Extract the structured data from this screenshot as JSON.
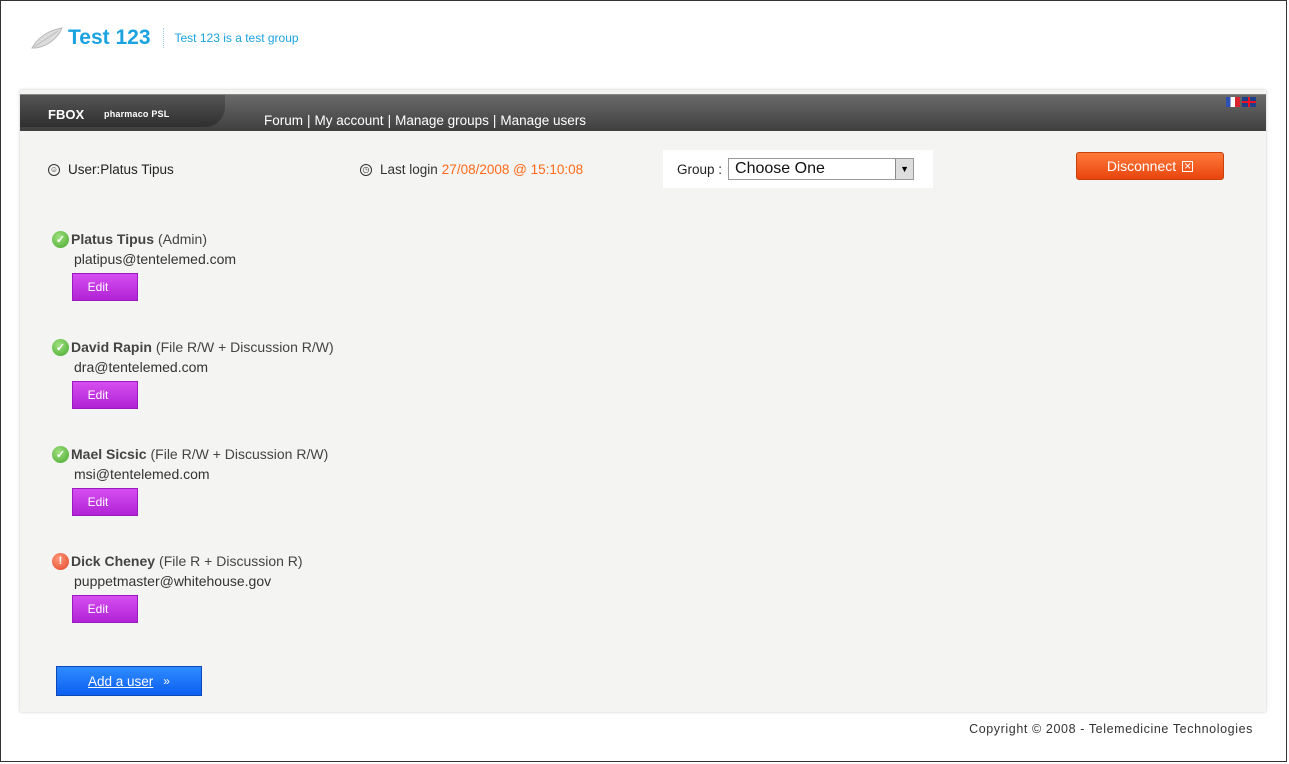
{
  "site": {
    "title": "Test 123",
    "description": "Test 123 is a test group"
  },
  "nav": {
    "brand_main": "FBOX",
    "brand_sub": "pharmaco PSL",
    "links": [
      "Forum",
      "My account",
      "Manage groups",
      "Manage users"
    ],
    "separator": "|"
  },
  "info": {
    "user_label": "User:Platus Tipus",
    "last_login_label": "Last login",
    "last_login_time": "27/08/2008 @ 15:10:08",
    "group_label": "Group :",
    "group_selected": "Choose One",
    "disconnect_label": "Disconnect"
  },
  "users": [
    {
      "name": "Platus Tipus",
      "role": "(Admin)",
      "email": "platipus@tentelemed.com",
      "status": "ok",
      "edit_label": "Edit"
    },
    {
      "name": "David Rapin",
      "role": "(File R/W + Discussion R/W)",
      "email": "dra@tentelemed.com",
      "status": "ok",
      "edit_label": "Edit"
    },
    {
      "name": "Mael Sicsic",
      "role": "(File R/W + Discussion R/W)",
      "email": "msi@tentelemed.com",
      "status": "ok",
      "edit_label": "Edit"
    },
    {
      "name": "Dick Cheney",
      "role": "(File R + Discussion R)",
      "email": "puppetmaster@whitehouse.gov",
      "status": "warning",
      "edit_label": "Edit"
    }
  ],
  "add_user_label": "Add a user",
  "copyright": "Copyright © 2008 - Telemedicine Technologies",
  "colors": {
    "title_blue": "#1aa3e0",
    "login_orange": "#ff6a1a",
    "disconnect_orange": "#e8450e",
    "edit_purple": "#b023d6",
    "add_blue": "#0d5ff0"
  }
}
